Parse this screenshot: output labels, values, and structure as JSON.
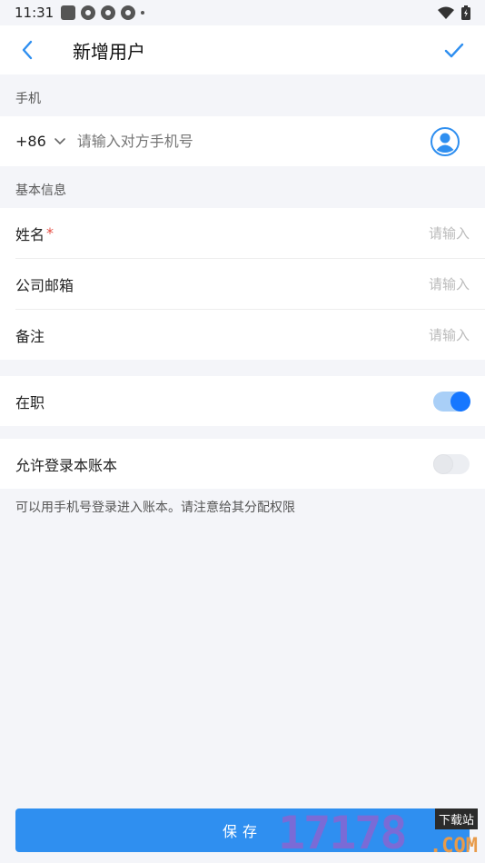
{
  "status": {
    "time": "11:31"
  },
  "header": {
    "title": "新增用户"
  },
  "phone": {
    "section_label": "手机",
    "country_code": "+86",
    "placeholder": "请输入对方手机号"
  },
  "basic": {
    "section_label": "基本信息",
    "fields": [
      {
        "label": "姓名",
        "required_mark": "*",
        "placeholder": "请输入"
      },
      {
        "label": "公司邮箱",
        "placeholder": "请输入"
      },
      {
        "label": "备注",
        "placeholder": "请输入"
      }
    ]
  },
  "employment": {
    "label": "在职",
    "enabled": true
  },
  "login": {
    "label": "允许登录本账本",
    "enabled": false,
    "hint": "可以用手机号登录进入账本。请注意给其分配权限"
  },
  "footer": {
    "save_label": "保存"
  },
  "watermark": {
    "number": "17178",
    "tag": "下载站",
    "suffix": ".COM"
  },
  "colors": {
    "accent": "#2f8ff0",
    "toggle_on": "#1677ff",
    "required": "#e54d42"
  }
}
